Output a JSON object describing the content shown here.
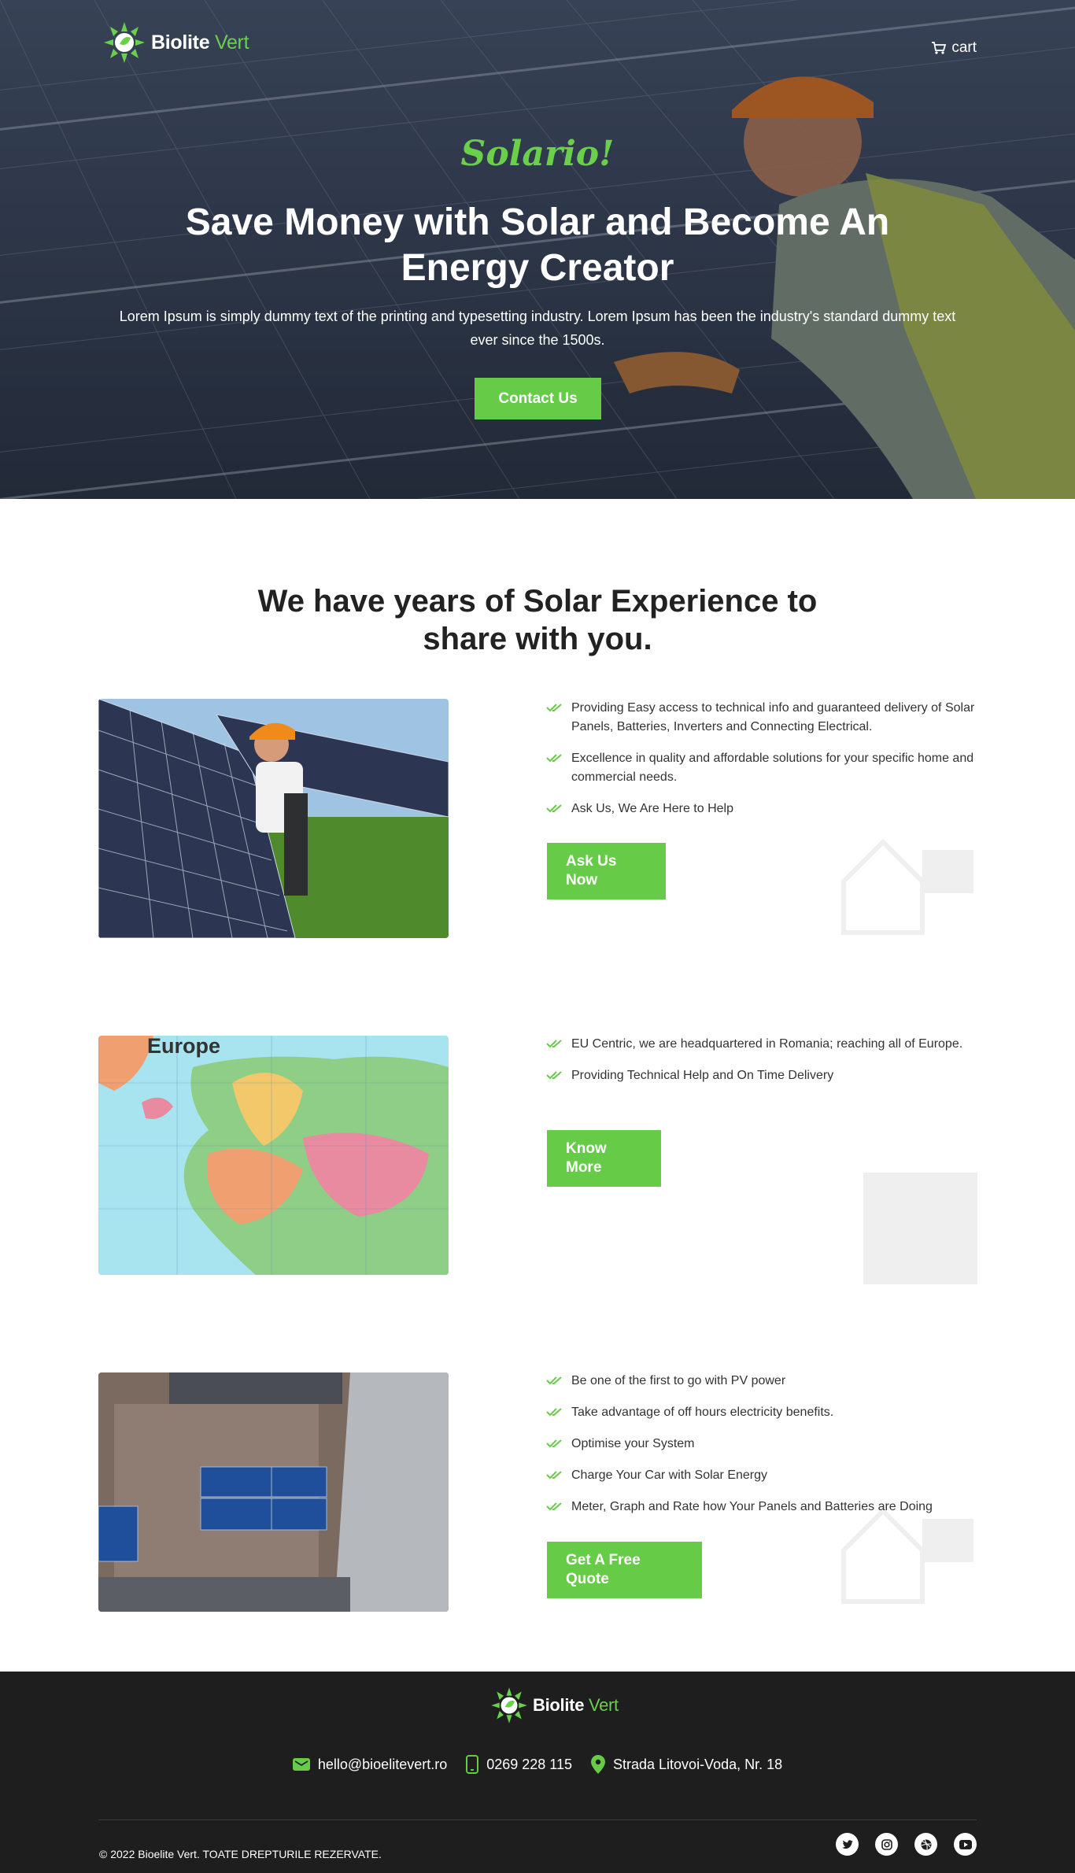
{
  "header": {
    "logo": {
      "name": "Biolite",
      "accent": "Vert"
    },
    "cart_label": "cart"
  },
  "hero": {
    "script_title": "Solario!",
    "title": "Save Money with Solar and Become An Energy Creator",
    "text": "Lorem Ipsum is simply dummy text of the printing and typesetting industry. Lorem Ipsum has been the industry's standard dummy text ever since the 1500s.",
    "cta": "Contact Us"
  },
  "intro": {
    "title": "We have years of Solar Experience to share with you."
  },
  "features": [
    {
      "image": "worker-installing-solar-panels",
      "items": [
        "Providing Easy access to technical info and guaranteed delivery of Solar Panels, Batteries, Inverters and Connecting Electrical.",
        "Excellence in quality and affordable solutions for your specific home and commercial needs.",
        "Ask Us, We Are Here to Help"
      ],
      "button": "Ask Us Now"
    },
    {
      "image": "europe-map",
      "image_label": "Europe",
      "items": [
        "EU Centric, we are headquartered in Romania; reaching all of Europe.",
        "Providing Technical Help and On Time Delivery"
      ],
      "button": "Know More"
    },
    {
      "image": "house-roof-solar-panels",
      "items": [
        "Be one of the first to go with PV power",
        "Take advantage of off hours electricity benefits.",
        "Optimise your System",
        "Charge Your Car with Solar Energy",
        "Meter, Graph and Rate how Your Panels and Batteries are Doing"
      ],
      "button": "Get A Free Quote"
    }
  ],
  "footer": {
    "email": "hello@bioelitevert.ro",
    "phone": "0269 228 115",
    "address": "Strada Litovoi-Voda, Nr. 18",
    "copyright": "© 2022 Bioelite Vert. TOATE DREPTURILE REZERVATE.",
    "socials": [
      "twitter-icon",
      "instagram-icon",
      "dribbble-icon",
      "youtube-icon"
    ]
  },
  "colors": {
    "accent": "#66cc47",
    "footer_bg": "#1d1e1d",
    "text": "#222222"
  }
}
